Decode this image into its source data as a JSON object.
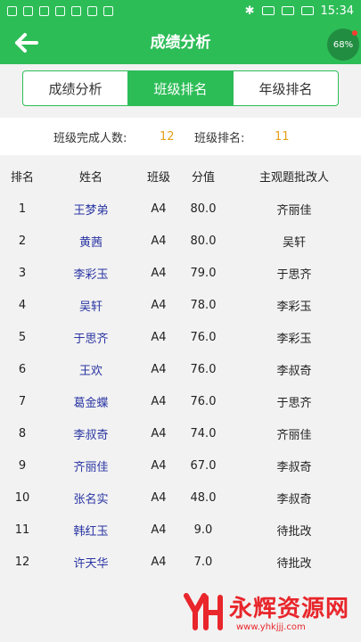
{
  "statusbar": {
    "time": "15:34"
  },
  "appbar": {
    "title": "成绩分析"
  },
  "badge": {
    "text": "68%"
  },
  "tabs": [
    {
      "label": "成绩分析",
      "active": false
    },
    {
      "label": "班级排名",
      "active": true
    },
    {
      "label": "年级排名",
      "active": false
    }
  ],
  "summary": {
    "completed_label": "班级完成人数:",
    "completed_value": "12",
    "rank_label": "班级排名:",
    "rank_value": "11"
  },
  "table": {
    "headers": [
      "排名",
      "姓名",
      "班级",
      "分值",
      "主观题批改人"
    ],
    "rows": [
      [
        "1",
        "王梦弟",
        "A4",
        "80.0",
        "齐丽佳"
      ],
      [
        "2",
        "黄茜",
        "A4",
        "80.0",
        "吴轩"
      ],
      [
        "3",
        "李彩玉",
        "A4",
        "79.0",
        "于思齐"
      ],
      [
        "4",
        "吴轩",
        "A4",
        "78.0",
        "李彩玉"
      ],
      [
        "5",
        "于思齐",
        "A4",
        "76.0",
        "李彩玉"
      ],
      [
        "6",
        "王欢",
        "A4",
        "76.0",
        "李叔奇"
      ],
      [
        "7",
        "葛金蝶",
        "A4",
        "76.0",
        "于思齐"
      ],
      [
        "8",
        "李叔奇",
        "A4",
        "74.0",
        "齐丽佳"
      ],
      [
        "9",
        "齐丽佳",
        "A4",
        "67.0",
        "李叔奇"
      ],
      [
        "10",
        "张名实",
        "A4",
        "48.0",
        "李叔奇"
      ],
      [
        "11",
        "韩红玉",
        "A4",
        "9.0",
        "待批改"
      ],
      [
        "12",
        "许天华",
        "A4",
        "7.0",
        "待批改"
      ]
    ]
  },
  "watermark": {
    "text": "永辉资源网",
    "url": "www.yhkjjj.com"
  },
  "colors": {
    "primary": "#2dbd57",
    "accent": "#e5a11c",
    "name_link": "#2a35a3",
    "watermark": "#e8262b"
  }
}
